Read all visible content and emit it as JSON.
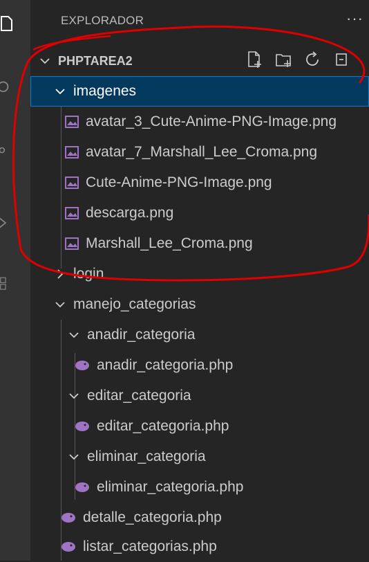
{
  "explorer": {
    "title": "EXPLORADOR",
    "more": "···"
  },
  "project": {
    "name": "PHPTAREA2"
  },
  "tree": {
    "imagenes": "imagenes",
    "files_img": [
      "avatar_3_Cute-Anime-PNG-Image.png",
      "avatar_7_Marshall_Lee_Croma.png",
      "Cute-Anime-PNG-Image.png",
      "descarga.png",
      "Marshall_Lee_Croma.png"
    ],
    "login": "login",
    "manejo_categorias": "manejo_categorias",
    "anadir_folder": "anadir_categoria",
    "anadir_file": "anadir_categoria.php",
    "editar_folder": "editar_categoria",
    "editar_file": "editar_categoria.php",
    "eliminar_folder": "eliminar_categoria",
    "eliminar_file": "eliminar_categoria.php",
    "detalle_file": "detalle_categoria.php",
    "listar_file": "listar_categorias.php"
  },
  "colors": {
    "selection": "#04395e",
    "focus_border": "#007fd4",
    "annotation": "#e00000",
    "image_icon": "#a074c4",
    "php_icon": "#a074c4"
  },
  "icons": {
    "new_file": "new-file-icon",
    "new_folder": "new-folder-icon",
    "refresh": "refresh-icon",
    "collapse": "collapse-all-icon"
  }
}
